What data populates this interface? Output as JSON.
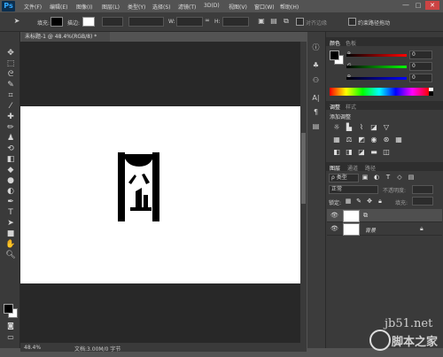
{
  "app": {
    "logo": "Ps"
  },
  "menu": [
    "文件(F)",
    "编辑(E)",
    "图像(I)",
    "图层(L)",
    "类型(Y)",
    "选择(S)",
    "滤镜(T)",
    "3D(D)",
    "视图(V)",
    "窗口(W)",
    "帮助(H)"
  ],
  "window_controls": {
    "minimize": "—",
    "maximize": "□",
    "close": "✕"
  },
  "options_bar": {
    "fill_label": "填充:",
    "stroke_label": "描边:",
    "w_label": "W:",
    "h_label": "H:",
    "align_edges_label": "对齐边缘",
    "constrain_label": "约束路径拖动"
  },
  "document": {
    "tab_title": "未标题-1 @ 48.4%(RGB/8) *",
    "zoom": "48.4%",
    "doc_info": "文档:3.00M/0 字节"
  },
  "colors": {
    "foreground": "#000000",
    "background": "#ffffff",
    "r_value": "0",
    "g_value": "0",
    "b_value": "0"
  },
  "color_panel": {
    "tab_color": "颜色",
    "tab_swatches": "色板",
    "r": "R",
    "g": "G",
    "b": "B"
  },
  "adjustments_panel": {
    "tab_adjust": "调整",
    "tab_styles": "样式",
    "add_adjustment": "添加调整"
  },
  "layers_panel": {
    "tab_layers": "图层",
    "tab_channels": "通道",
    "tab_paths": "路径",
    "kind_filter": "ρ 类型",
    "blend_mode": "正常",
    "opacity_label": "不透明度:",
    "lock_label": "锁定:",
    "fill_label": "填充:",
    "layers": [
      {
        "name": "",
        "type": "shape",
        "visible": true
      },
      {
        "name": "背景",
        "type": "background",
        "visible": true,
        "locked": true
      }
    ]
  },
  "watermark": {
    "site": "jb51.net",
    "name": "脚本之家"
  }
}
